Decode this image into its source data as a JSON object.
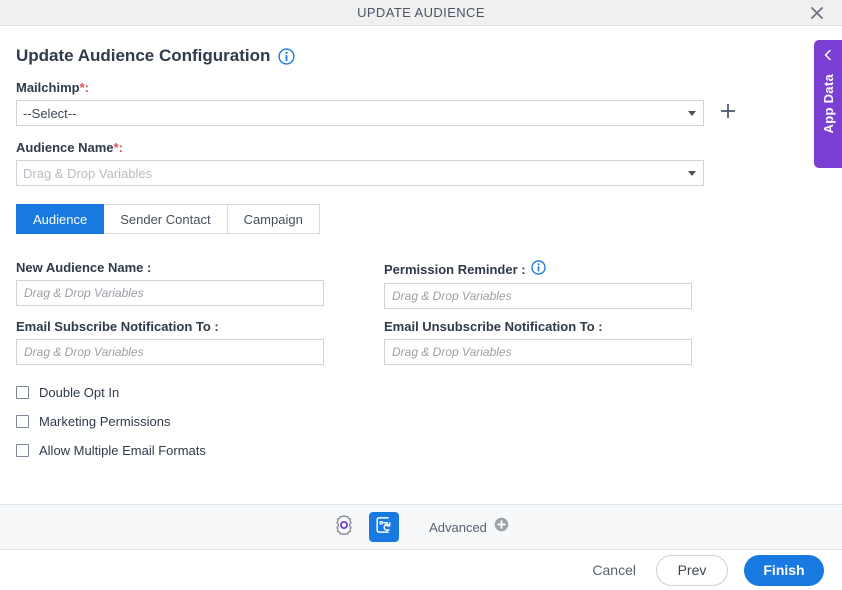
{
  "titlebar": {
    "title": "UPDATE AUDIENCE",
    "close_icon": "close-icon"
  },
  "page": {
    "heading": "Update Audience Configuration",
    "heading_info_icon": "info-icon"
  },
  "mailchimp": {
    "label": "Mailchimp",
    "required_mark": "*:",
    "selected_value": "--Select--",
    "caret_icon": "chevron-down-icon",
    "add_icon": "plus-icon"
  },
  "audience_name": {
    "label": "Audience Name",
    "required_mark": "*:",
    "placeholder": "Drag & Drop Variables",
    "caret_icon": "chevron-down-icon"
  },
  "tabs": [
    {
      "label": "Audience",
      "active": true
    },
    {
      "label": "Sender Contact",
      "active": false
    },
    {
      "label": "Campaign",
      "active": false
    }
  ],
  "fields": {
    "new_audience_name": {
      "label": "New Audience Name :",
      "placeholder": "Drag & Drop Variables",
      "value": ""
    },
    "permission_reminder": {
      "label": "Permission Reminder :",
      "placeholder": "Drag & Drop Variables",
      "value": "",
      "info_icon": "info-icon"
    },
    "email_subscribe": {
      "label": "Email Subscribe Notification To :",
      "placeholder": "Drag & Drop Variables",
      "value": ""
    },
    "email_unsubscribe": {
      "label": "Email Unsubscribe Notification To :",
      "placeholder": "Drag & Drop Variables",
      "value": ""
    }
  },
  "checkboxes": [
    {
      "label": "Double Opt In",
      "checked": false
    },
    {
      "label": "Marketing Permissions",
      "checked": false
    },
    {
      "label": "Allow Multiple Email Formats",
      "checked": false
    }
  ],
  "app_data": {
    "label": "App Data",
    "chevron_icon": "chevron-left-icon",
    "color": "#7c3fd4"
  },
  "toolbar": {
    "settings_icon": "gear-icon",
    "variables_icon": "card-refresh-icon",
    "advanced_label": "Advanced",
    "advanced_add_icon": "plus-circle-icon"
  },
  "footer": {
    "cancel_label": "Cancel",
    "prev_label": "Prev",
    "finish_label": "Finish"
  },
  "colors": {
    "accent_blue": "#1879e0",
    "purple": "#7c3fd4",
    "required_red": "#d9534f"
  }
}
